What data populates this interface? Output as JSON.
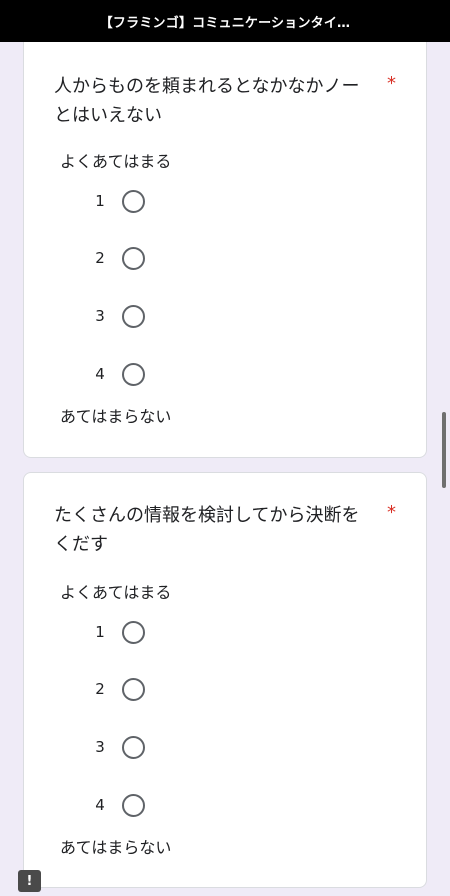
{
  "header": {
    "title": "【フラミンゴ】コミュニケーションタイ…"
  },
  "questions": [
    {
      "title_line1": "人からものを頼まれるとなかなかノー",
      "title_line2": "とはいえない",
      "required_mark": "*",
      "low_label": "よくあてはまる",
      "high_label": "あてはまらない",
      "options": [
        {
          "label": "1",
          "selected": false
        },
        {
          "label": "2",
          "selected": false
        },
        {
          "label": "3",
          "selected": false
        },
        {
          "label": "4",
          "selected": false
        }
      ]
    },
    {
      "title_line1": "たくさんの情報を検討してから決断を",
      "title_line2": "くだす",
      "required_mark": "*",
      "low_label": "よくあてはまる",
      "high_label": "あてはまらない",
      "options": [
        {
          "label": "1",
          "selected": false
        },
        {
          "label": "2",
          "selected": false
        },
        {
          "label": "3",
          "selected": false
        },
        {
          "label": "4",
          "selected": false
        }
      ]
    }
  ],
  "feedback": {
    "icon": "!"
  },
  "colors": {
    "required": "#d93025",
    "background": "#efebf7",
    "radio_border": "#5f6368"
  }
}
